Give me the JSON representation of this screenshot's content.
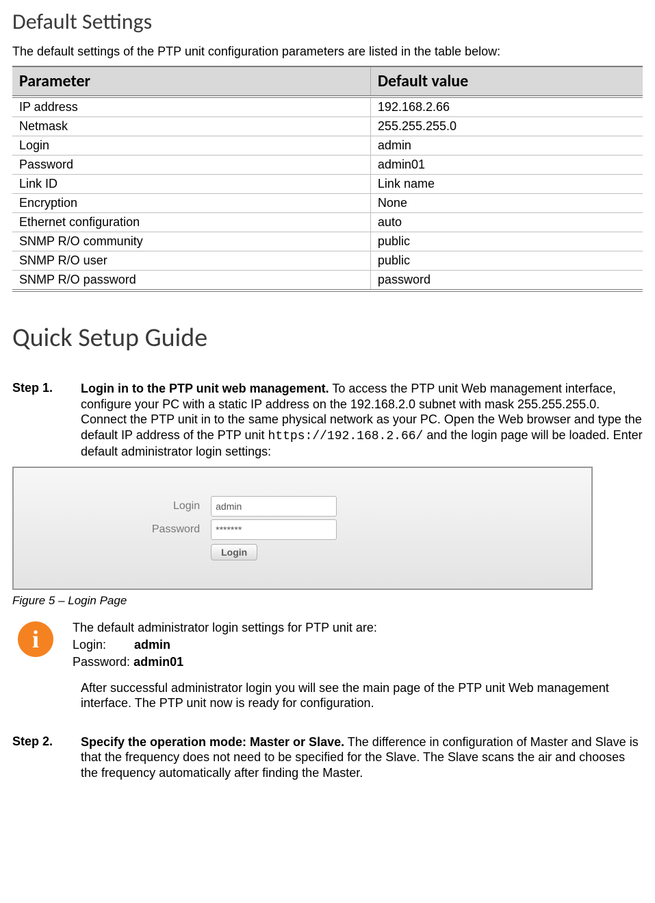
{
  "sections": {
    "default_settings": {
      "heading": "Default Settings",
      "intro": "The default settings of the PTP unit configuration parameters are listed in the table below:"
    },
    "quick_setup": {
      "heading": "Quick Setup Guide"
    }
  },
  "table": {
    "headers": {
      "param": "Parameter",
      "value": "Default value"
    },
    "rows": [
      {
        "param": "IP address",
        "value": "192.168.2.66"
      },
      {
        "param": "Netmask",
        "value": "255.255.255.0"
      },
      {
        "param": "Login",
        "value": "admin"
      },
      {
        "param": "Password",
        "value": "admin01"
      },
      {
        "param": "Link ID",
        "value": "Link name"
      },
      {
        "param": "Encryption",
        "value": "None"
      },
      {
        "param": "Ethernet configuration",
        "value": "auto"
      },
      {
        "param": "SNMP R/O community",
        "value": "public"
      },
      {
        "param": "SNMP R/O user",
        "value": "public"
      },
      {
        "param": "SNMP R/O password",
        "value": "password"
      }
    ]
  },
  "step1": {
    "label": "Step 1.",
    "lead": "Login in to the PTP unit web management.",
    "text_before_url": " To access the PTP unit Web management interface, configure your PC with a static IP address on the 192.168.2.0 subnet with mask 255.255.255.0. Connect the PTP unit in to the same physical network as your PC. Open the Web browser and type the default IP address of the PTP unit ",
    "url": "https://192.168.2.66/",
    "text_after_url": " and the login page will be loaded. Enter default administrator login settings:"
  },
  "login_panel": {
    "login_label": "Login",
    "password_label": "Password",
    "login_value": "admin",
    "password_value": "*******",
    "button": "Login"
  },
  "figure_caption": "Figure 5 – Login Page",
  "info": {
    "line1": "The default administrator login settings for PTP unit are:",
    "login_key": "Login:",
    "login_val": "admin",
    "pass_key": "Password:",
    "pass_val": "admin01",
    "after": "After successful administrator login you will see the main page of the PTP unit Web management interface. The PTP unit now is ready for configuration."
  },
  "step2": {
    "label": "Step 2.",
    "lead": "Specify the operation mode: Master or Slave.",
    "text": " The difference in configuration of Master and Slave is that the frequency does not need to be specified for the Slave. The Slave scans the air and chooses the frequency automatically after finding the Master."
  }
}
